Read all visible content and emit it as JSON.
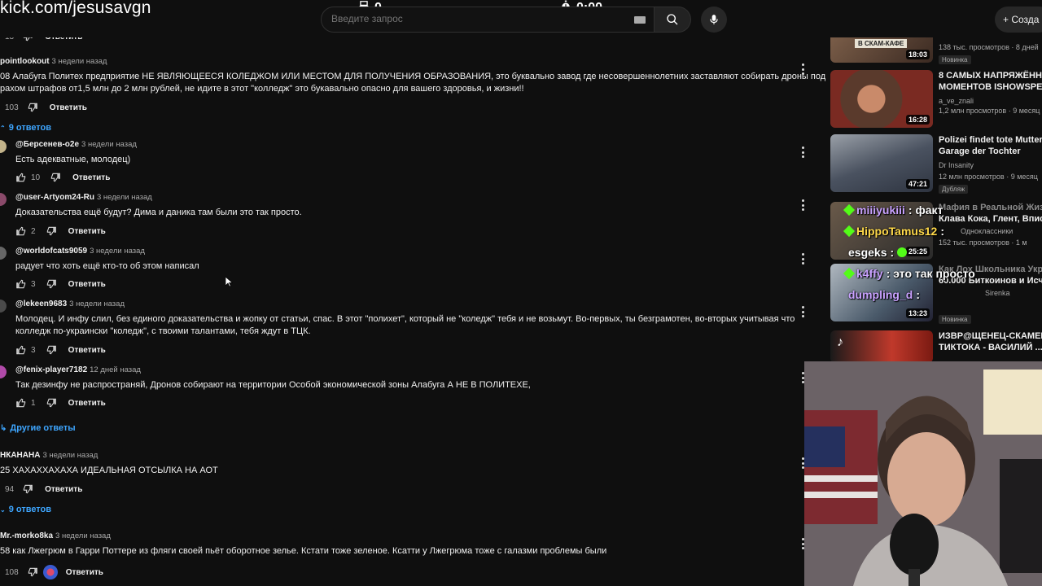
{
  "overlay": {
    "url": "kick.com/jesusavgn",
    "counter": "0",
    "timer": "0:00"
  },
  "search": {
    "placeholder": "Введите запрос"
  },
  "create_label": "+ Созда",
  "top_partial": {
    "likes": "13",
    "reply_label": "Ответить"
  },
  "comments": [
    {
      "author": "pointlookout",
      "time": "3 недели назад",
      "text1": "08 Алабуга Политех предприятие НЕ ЯВЛЯЮЩЕЕСЯ КОЛЕДЖОМ ИЛИ МЕСТОМ ДЛЯ ПОЛУЧЕНИЯ ОБРАЗОВАНИЯ, это буквально завод где несовершеннолетних заставляют собирать дроны под",
      "text2": "рахом штрафов от1,5 млн до 2 млн рублей, не идите в этот \"колледж\" это букавально опасно для вашего здоровья, и жизни!!",
      "likes": "103",
      "reply": "Ответить",
      "replies_toggle": "9 ответов"
    }
  ],
  "replies": [
    {
      "author": "@Берсенев-о2е",
      "time": "3 недели назад",
      "text": "Есть адекватные, молодец)",
      "likes": "10",
      "reply": "Ответить"
    },
    {
      "author": "@user-Artyom24-Ru",
      "time": "3 недели назад",
      "text": "Доказательства ещё будут? Дима и даника там были это так просто.",
      "likes": "2",
      "reply": "Ответить"
    },
    {
      "author": "@worldofcats9059",
      "time": "3 недели назад",
      "text": "радует что хоть ещё кто-то об этом написал",
      "likes": "3",
      "reply": "Ответить"
    },
    {
      "author": "@lekeen9683",
      "time": "3 недели назад",
      "text1": "Молодец. И инфу слил, без единого доказательства и жопку от статьи, спас. В этот \"полихет\", который не \"коледж\" тебя и не возьмут. Во-первых, ты безграмотен, во-вторых учитывая что",
      "text2": "колледж по-украински \"коледж\", с твоими талантами, тебя ждут в ТЦК.",
      "likes": "3",
      "reply": "Ответить"
    },
    {
      "author": "@fenix-player7182",
      "time": "12 дней назад",
      "text": "Так дезинфу не распространяй, Дронов собирают на территории Особой экономической зоны Алабуга А НЕ В ПОЛИТЕХЕ,",
      "likes": "1",
      "reply": "Ответить"
    }
  ],
  "more_replies": "Другие ответы",
  "comment2": {
    "author": "НКАНАНА",
    "time": "3 недели назад",
    "text": "25 ХАХАХХАХАХА ИДЕАЛЬНАЯ ОТСЫЛКА НА АОТ",
    "likes": "94",
    "reply": "Ответить",
    "replies_toggle": "9 ответов"
  },
  "comment3": {
    "author": "Mr.-morko8ka",
    "time": "3 недели назад",
    "text": "58 как Лжегрюм в Гарри Поттере из фляги своей пьёт оборотное зелье. Кстати тоже зеленое. Ксатти у Лжегрюма тоже с галазми проблемы были",
    "likes": "108",
    "reply": "Ответить"
  },
  "sidebar": [
    {
      "title1": "",
      "title2": "",
      "meta1": "138 тыс. просмотров · 8 дней",
      "badge": "Новинка",
      "duration": "18:03",
      "thumb_text": "В СКАМ-КАФЕ"
    },
    {
      "title1": "8 САМЫХ НАПРЯЖЁННЫ",
      "title2": "МОМЕНТОВ ISHOWSPEED",
      "meta1": "a_ve_znali",
      "meta2": "1,2 млн просмотров · 9 месяц",
      "duration": "16:28"
    },
    {
      "title1": "Polizei findet tote Mutter in",
      "title2": "Garage der Tochter",
      "meta1": "Dr Insanity",
      "meta2": "12 млн просмотров · 9 месяц",
      "badge": "Дубляж",
      "duration": "47:21"
    },
    {
      "title1": "Мафия в Реальной Жизн",
      "title2": "Клава Кока, Глент, Вписк",
      "meta1": "Одноклассники",
      "meta2": "152 тыс. просмотров · 1 м",
      "duration": "25:25"
    },
    {
      "title1": "Как Лох Школьника Укра",
      "title2": "60.000 Биткоинов и Исче",
      "meta1": "Sirenka",
      "meta2": "Новинка",
      "duration": "13:23"
    },
    {
      "title1": "ИЗВР@ЩЕНЕЦ-СКАМЕР",
      "title2": "ТИКТОКА - ВАСИЛИЙ ...",
      "meta1": "",
      "meta2": "",
      "duration": ""
    }
  ],
  "chat": [
    {
      "user": "miiiyukiii",
      "msg": ": факт",
      "color": "#c9a2ff"
    },
    {
      "user": "HippoTamus12",
      "msg": ":",
      "color": "#ffd94a"
    },
    {
      "user": "esgeks",
      "msg": ":",
      "color": "#ffffff"
    },
    {
      "user": "k4ffy",
      "msg": ": это так просто",
      "color": "#c9a2ff"
    },
    {
      "user": "dumpling_d",
      "msg": ":",
      "color": "#c9a2ff"
    }
  ],
  "colors": {
    "bg": "#0f0f0f",
    "link": "#3ea6ff",
    "kick_green": "#53fc18"
  }
}
